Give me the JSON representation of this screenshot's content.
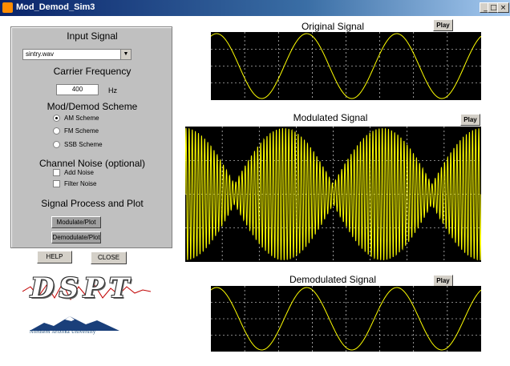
{
  "window": {
    "title": "Mod_Demod_Sim3",
    "min_glyph": "_",
    "max_glyph": "□",
    "close_glyph": "×"
  },
  "panel": {
    "input_signal_heading": "Input Signal",
    "input_file": "sintry.wav",
    "carrier_heading": "Carrier Frequency",
    "carrier_value": "400",
    "carrier_unit": "Hz",
    "scheme_heading": "Mod/Demod Scheme",
    "schemes": [
      {
        "label": "AM Scheme",
        "selected": true
      },
      {
        "label": "FM Scheme",
        "selected": false
      },
      {
        "label": "SSB Scheme",
        "selected": false
      }
    ],
    "noise_heading": "Channel Noise (optional)",
    "noise_options": [
      {
        "label": "Add Noise",
        "checked": false
      },
      {
        "label": "Filter Noise",
        "checked": false
      }
    ],
    "process_heading": "Signal Process and Plot",
    "modulate_button": "Modulate/Plot",
    "demodulate_button": "Demodulate/Plot"
  },
  "buttons": {
    "help": "HELP",
    "close": "CLOSE"
  },
  "plots": {
    "original": {
      "title": "Original Signal",
      "play": "Play"
    },
    "modulated": {
      "title": "Modulated Signal",
      "play": "Play"
    },
    "demodulated": {
      "title": "Demodulated Signal",
      "play": "Play"
    }
  },
  "logo": {
    "text": "DSPT",
    "university": "Northern Arizona University"
  },
  "colors": {
    "trace": "#ffff00",
    "plot_bg": "#000000",
    "grid": "#ffffff",
    "panel": "#c0c0c0"
  }
}
